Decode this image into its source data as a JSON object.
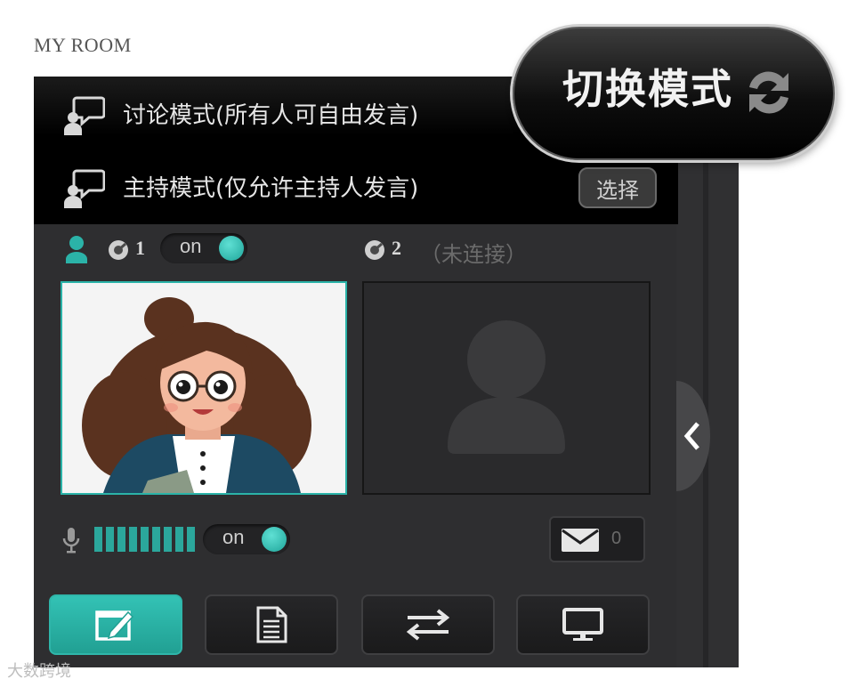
{
  "room": {
    "title": "MY ROOM"
  },
  "mode_menu": {
    "items": [
      {
        "label": "讨论模式(所有人可自由发言)",
        "icon": "speech-person-icon"
      },
      {
        "label": "主持模式(仅允许主持人发言)",
        "icon": "speech-person-icon"
      }
    ],
    "select_label": "选择"
  },
  "switch_mode": {
    "label": "切换模式",
    "icon": "refresh-arrows-icon"
  },
  "slots": [
    {
      "number": "1",
      "toggle": "on",
      "status": ""
    },
    {
      "number": "2",
      "status": "（未连接）"
    }
  ],
  "audio": {
    "toggle": "on",
    "level_bars": 9
  },
  "messages": {
    "count": "0",
    "icon": "envelope-icon"
  },
  "toolbar": {
    "buttons": [
      {
        "icon": "whiteboard-edit-icon",
        "active": true
      },
      {
        "icon": "document-icon",
        "active": false
      },
      {
        "icon": "swap-arrows-icon",
        "active": false
      },
      {
        "icon": "screen-share-icon",
        "active": false
      }
    ]
  },
  "watermark": {
    "text": "大数跨境"
  },
  "colors": {
    "accent": "#2bb3a8",
    "panel": "#2e2e30",
    "menu": "#000000"
  }
}
